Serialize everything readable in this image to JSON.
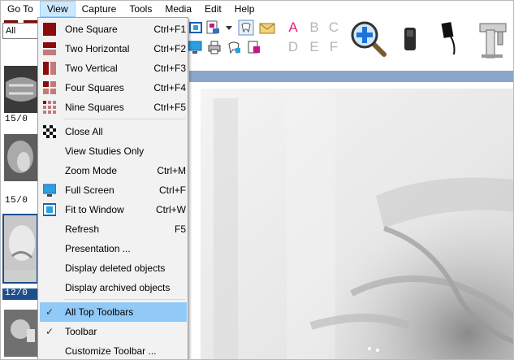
{
  "menubar": {
    "items": [
      "Go To",
      "View",
      "Capture",
      "Tools",
      "Media",
      "Edit",
      "Help"
    ]
  },
  "toolbar": {
    "filter_value": "All",
    "letters_top": [
      "A",
      "B",
      "C"
    ],
    "letters_bottom": [
      "D",
      "E",
      "F"
    ]
  },
  "sidebar": {
    "thumb_labels": [
      "15/0",
      "15/0",
      "12/0"
    ]
  },
  "view_menu": {
    "items": [
      {
        "label": "One Square",
        "shortcut": "Ctrl+F1"
      },
      {
        "label": "Two Horizontal",
        "shortcut": "Ctrl+F2"
      },
      {
        "label": "Two Vertical",
        "shortcut": "Ctrl+F3"
      },
      {
        "label": "Four Squares",
        "shortcut": "Ctrl+F4"
      },
      {
        "label": "Nine Squares",
        "shortcut": "Ctrl+F5"
      },
      {
        "label": "Close All",
        "shortcut": ""
      },
      {
        "label": "View Studies Only",
        "shortcut": ""
      },
      {
        "label": "Zoom Mode",
        "shortcut": "Ctrl+M"
      },
      {
        "label": "Full Screen",
        "shortcut": "Ctrl+F"
      },
      {
        "label": "Fit to Window",
        "shortcut": "Ctrl+W"
      },
      {
        "label": "Refresh",
        "shortcut": "F5"
      },
      {
        "label": "Presentation ...",
        "shortcut": ""
      },
      {
        "label": "Display deleted objects",
        "shortcut": ""
      },
      {
        "label": "Display archived objects",
        "shortcut": ""
      },
      {
        "label": "All Top Toolbars",
        "shortcut": ""
      },
      {
        "label": "Toolbar",
        "shortcut": ""
      },
      {
        "label": "Customize Toolbar ...",
        "shortcut": ""
      }
    ],
    "check_mark": "✓"
  },
  "colors": {
    "highlight": "#91c9f7",
    "accent_red": "#8b0a0a",
    "letter_pink": "#e0207a",
    "letter_gray": "#b5b5b5"
  }
}
